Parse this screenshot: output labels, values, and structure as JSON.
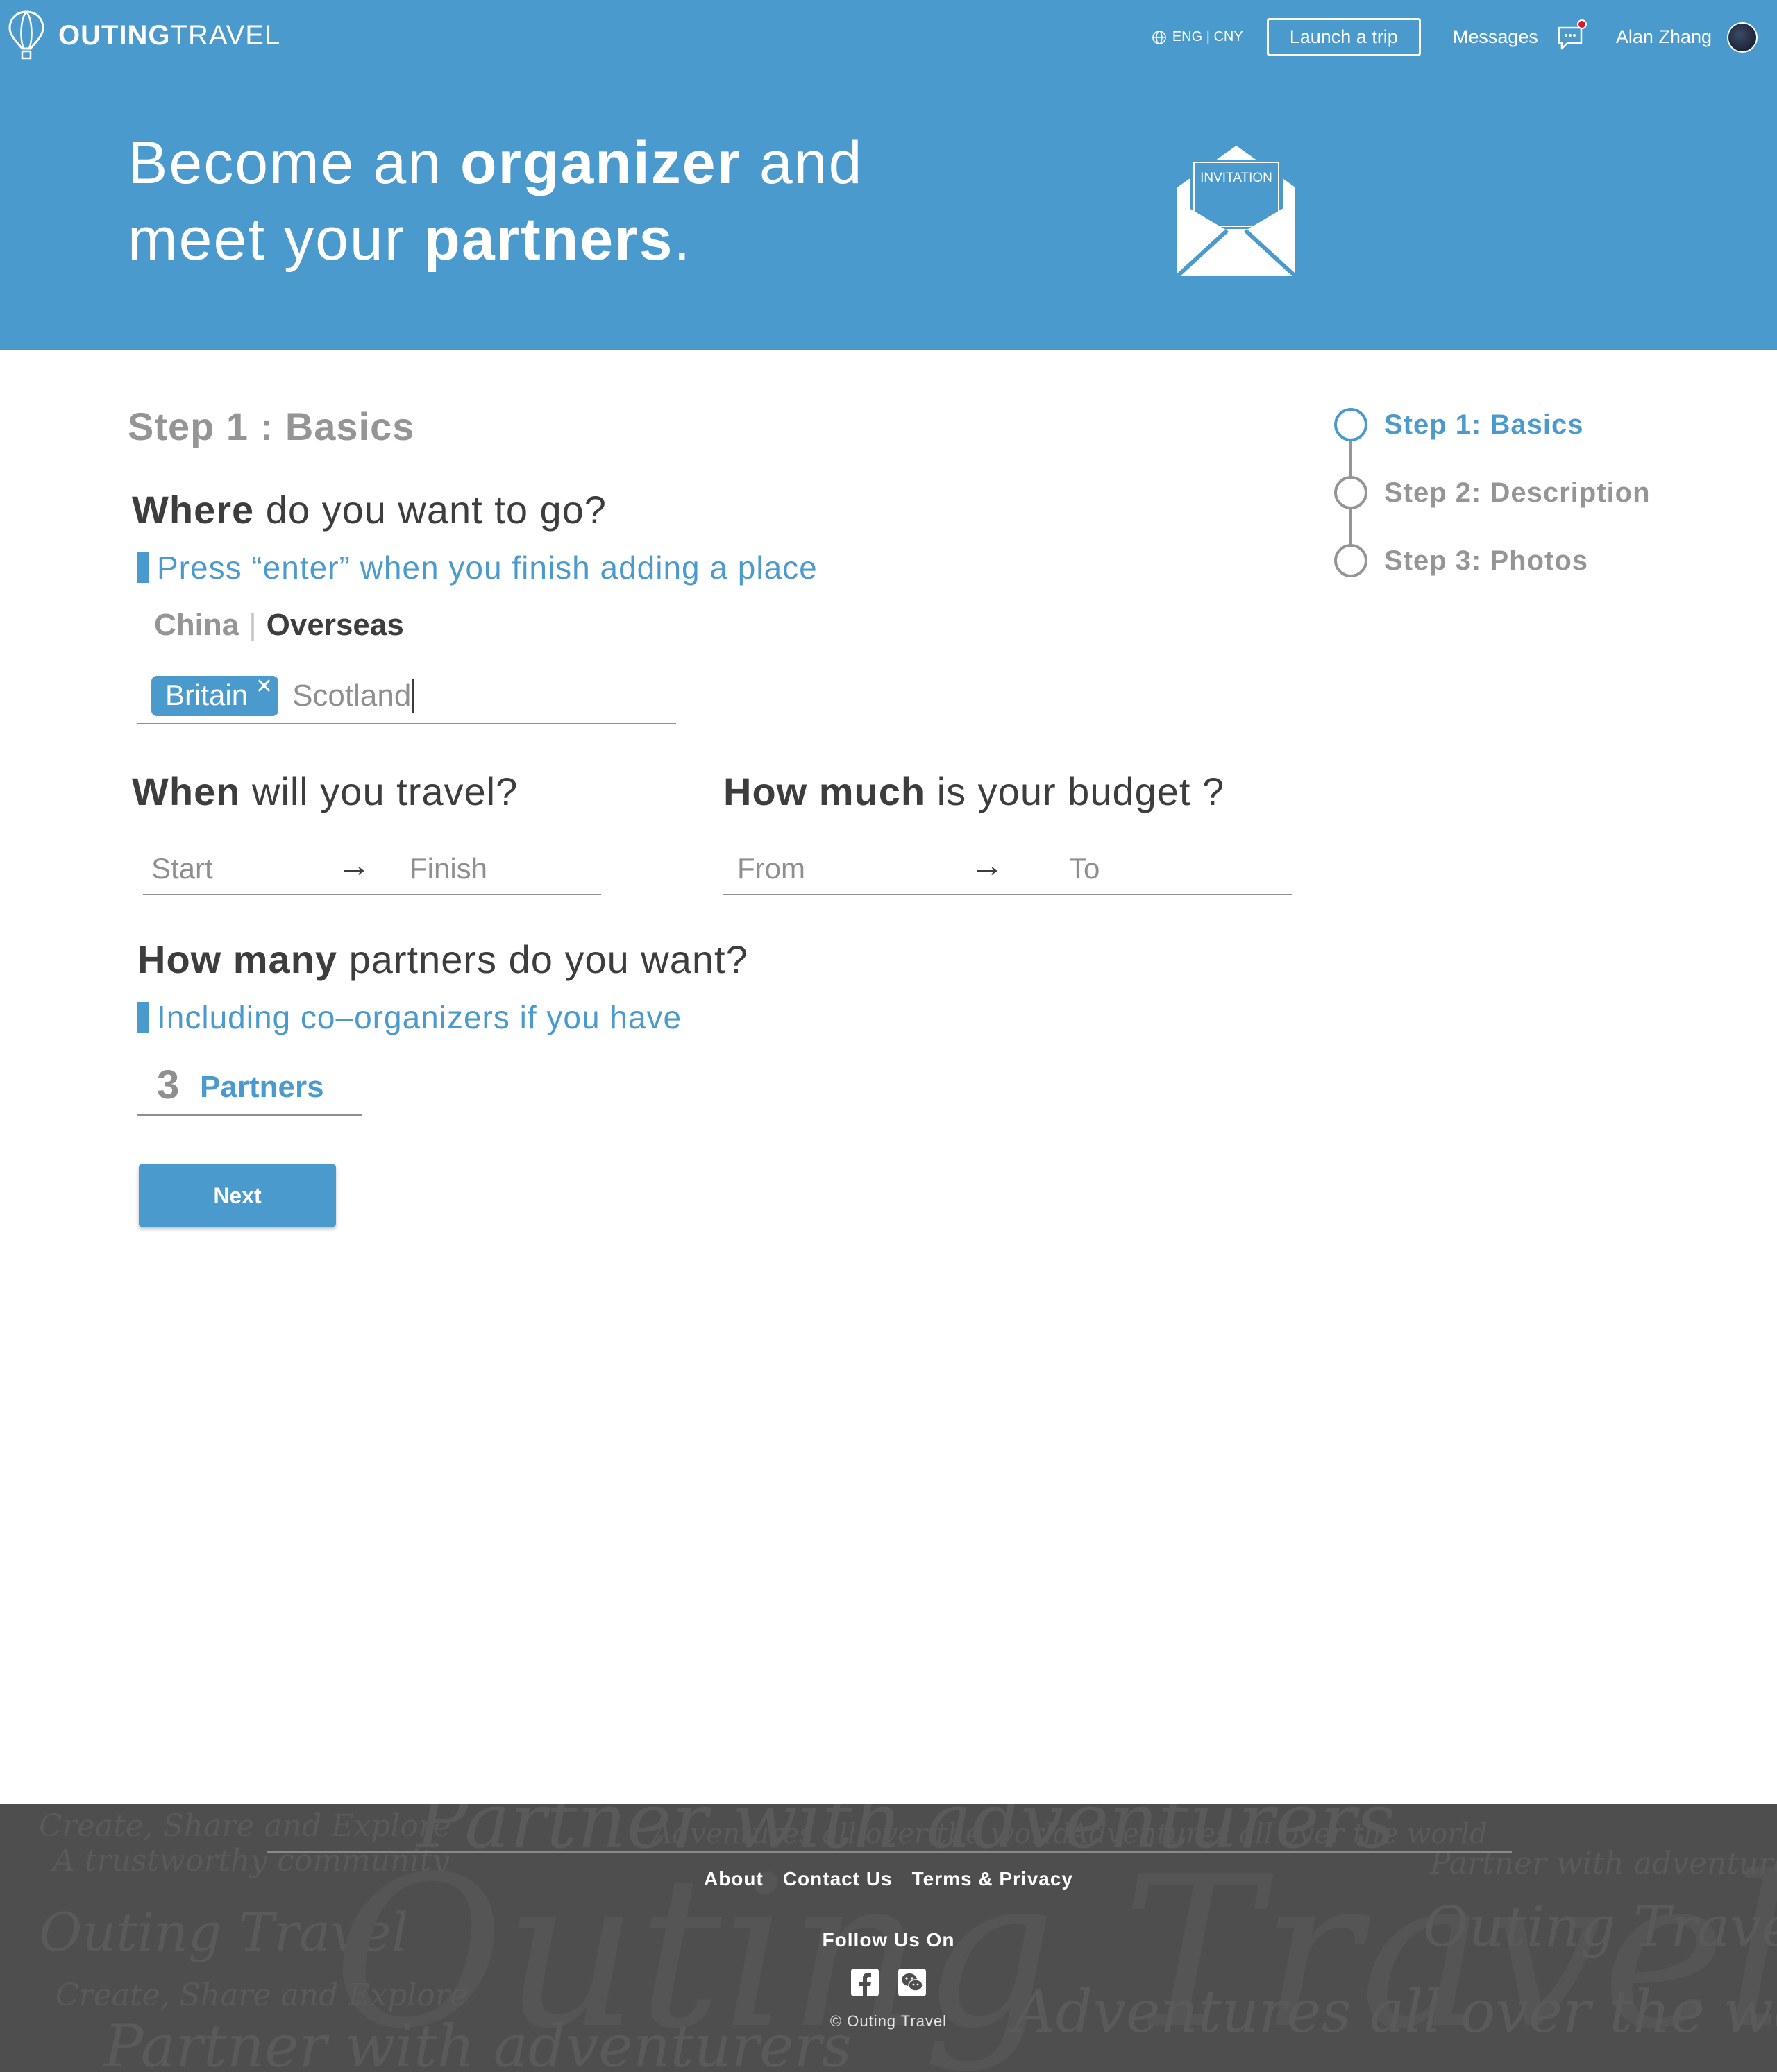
{
  "header": {
    "logo_bold": "OUTING",
    "logo_light": "TRAVEL",
    "language": "ENG | CNY",
    "launch_label": "Launch a trip",
    "messages_label": "Messages",
    "user_name": "Alan Zhang"
  },
  "hero": {
    "line1_a": "Become an ",
    "line1_b": "organizer",
    "line1_c": " and",
    "line2_a": "meet your ",
    "line2_b": "partners",
    "line2_c": ".",
    "envelope_label": "INVITATION"
  },
  "form": {
    "step_title": "Step 1 : Basics",
    "where": {
      "bold": "Where",
      "rest": " do you want to go?"
    },
    "where_hint": "Press “enter” when you finish adding a place",
    "region_options": [
      "China",
      "Overseas"
    ],
    "region_selected": "Overseas",
    "tags": [
      "Britain"
    ],
    "tag_input_value": "Scotland",
    "when": {
      "bold": "When",
      "rest": " will you travel?"
    },
    "date_start_placeholder": "Start",
    "date_finish_placeholder": "Finish",
    "budget": {
      "bold": "How much",
      "rest": " is your budget ?"
    },
    "budget_from_placeholder": "From",
    "budget_to_placeholder": "To",
    "arrow": "→",
    "partners_q": {
      "bold": "How many",
      "rest": " partners do you want?"
    },
    "partners_hint": "Including co–organizers if you have",
    "partners_count": "3",
    "partners_label": "Partners",
    "next_label": "Next"
  },
  "stepper": [
    {
      "label": "Step 1: Basics",
      "active": true
    },
    {
      "label": "Step 2: Description",
      "active": false
    },
    {
      "label": "Step 3: Photos",
      "active": false
    }
  ],
  "footer": {
    "links": [
      "About",
      "Contact Us",
      "Terms & Privacy"
    ],
    "follow_label": "Follow Us On",
    "social_icons": [
      "facebook-icon",
      "wechat-icon"
    ],
    "copyright": "© Outing Travel"
  },
  "colors": {
    "brand": "#4b9acd",
    "footer_bg": "#4e4e4e",
    "notification": "#e0182b"
  }
}
